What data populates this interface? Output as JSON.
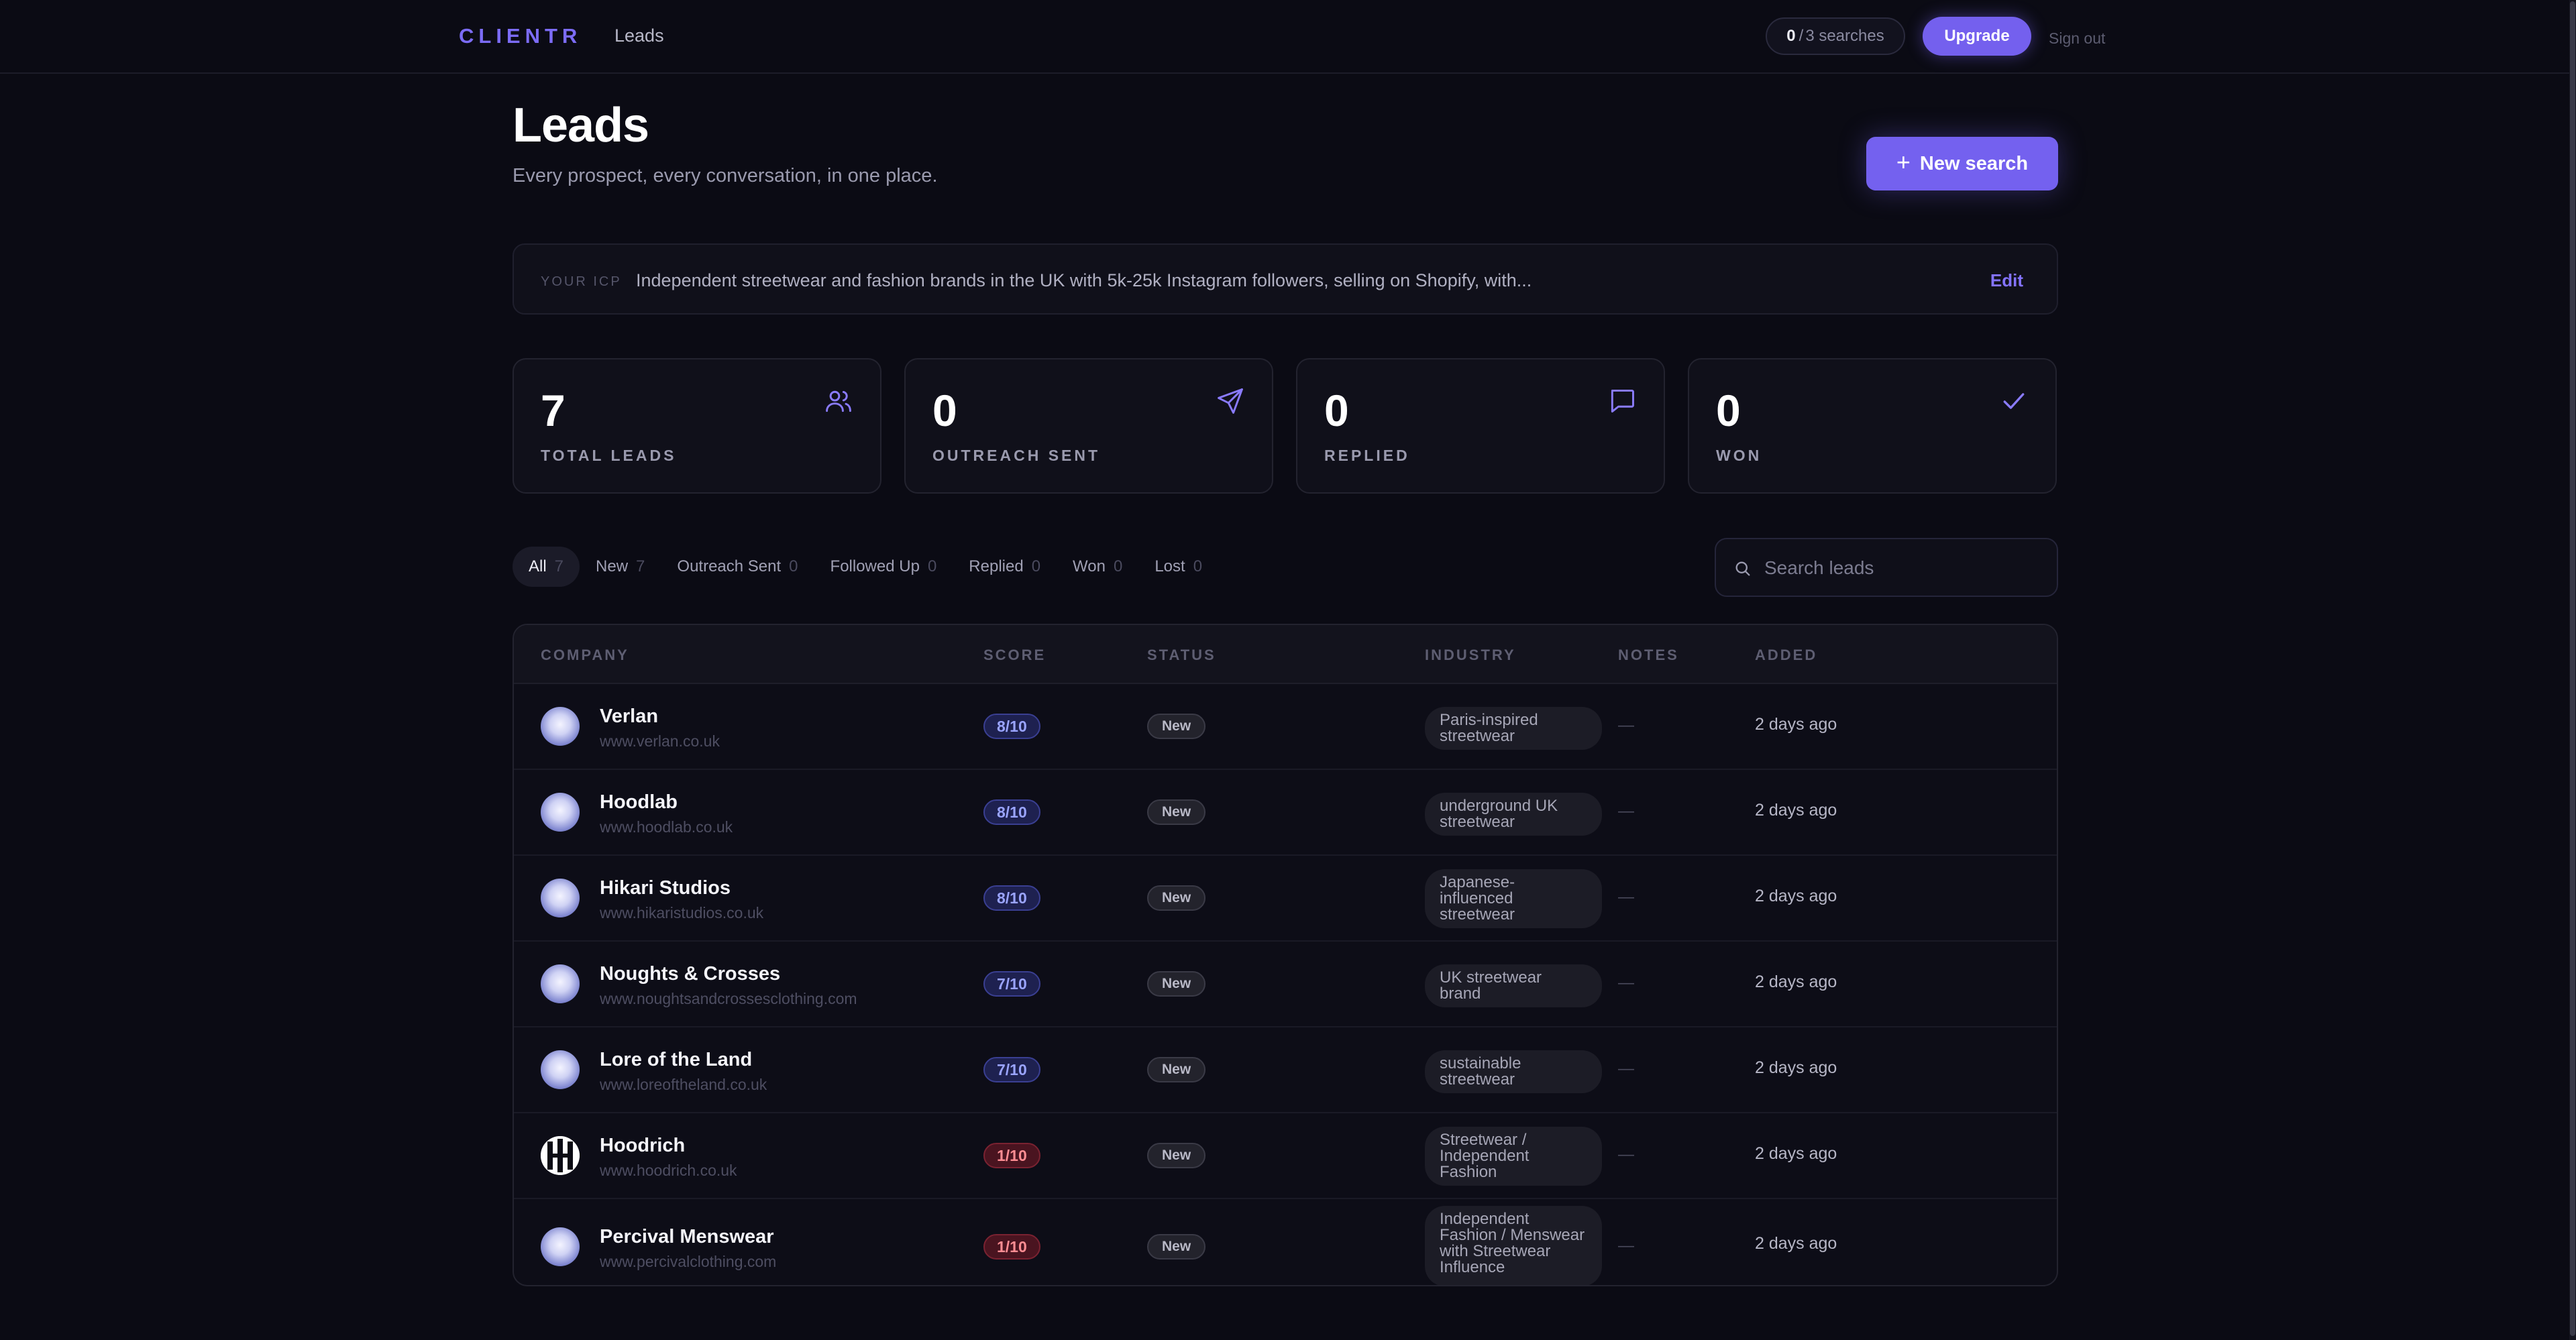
{
  "nav": {
    "brand": "CLIENTR",
    "leads_link": "Leads",
    "searches_used": "0",
    "searches_sep": "/",
    "searches_total": "3 searches",
    "upgrade_label": "Upgrade",
    "signout_label": "Sign out"
  },
  "header": {
    "title": "Leads",
    "subtitle": "Every prospect, every conversation, in one place.",
    "new_search_label": "New search"
  },
  "icp": {
    "label": "YOUR ICP",
    "text": "Independent streetwear and fashion brands in the UK with 5k-25k Instagram followers, selling on Shopify, with...",
    "edit_label": "Edit"
  },
  "stats": [
    {
      "value": "7",
      "label": "TOTAL LEADS",
      "icon": "users-icon"
    },
    {
      "value": "0",
      "label": "OUTREACH SENT",
      "icon": "send-icon"
    },
    {
      "value": "0",
      "label": "REPLIED",
      "icon": "message-icon"
    },
    {
      "value": "0",
      "label": "WON",
      "icon": "check-icon"
    }
  ],
  "filters": [
    {
      "label": "All",
      "count": "7"
    },
    {
      "label": "New",
      "count": "7"
    },
    {
      "label": "Outreach Sent",
      "count": "0"
    },
    {
      "label": "Followed Up",
      "count": "0"
    },
    {
      "label": "Replied",
      "count": "0"
    },
    {
      "label": "Won",
      "count": "0"
    },
    {
      "label": "Lost",
      "count": "0"
    }
  ],
  "search": {
    "placeholder": "Search leads"
  },
  "table": {
    "columns": [
      "COMPANY",
      "SCORE",
      "STATUS",
      "INDUSTRY",
      "NOTES",
      "ADDED"
    ],
    "rows": [
      {
        "name": "Verlan",
        "url": "www.verlan.co.uk",
        "score": "8/10",
        "status": "New",
        "industry": "Paris-inspired streetwear",
        "notes": "—",
        "added": "2 days ago"
      },
      {
        "name": "Hoodlab",
        "url": "www.hoodlab.co.uk",
        "score": "8/10",
        "status": "New",
        "industry": "underground UK streetwear",
        "notes": "—",
        "added": "2 days ago"
      },
      {
        "name": "Hikari Studios",
        "url": "www.hikaristudios.co.uk",
        "score": "8/10",
        "status": "New",
        "industry": "Japanese-influenced streetwear",
        "notes": "—",
        "added": "2 days ago"
      },
      {
        "name": "Noughts & Crosses",
        "url": "www.noughtsandcrossesclothing.com",
        "score": "7/10",
        "status": "New",
        "industry": "UK streetwear brand",
        "notes": "—",
        "added": "2 days ago"
      },
      {
        "name": "Lore of the Land",
        "url": "www.loreoftheland.co.uk",
        "score": "7/10",
        "status": "New",
        "industry": "sustainable streetwear",
        "notes": "—",
        "added": "2 days ago"
      },
      {
        "name": "Hoodrich",
        "url": "www.hoodrich.co.uk",
        "score": "1/10",
        "status": "New",
        "industry": "Streetwear / Independent Fashion",
        "notes": "—",
        "added": "2 days ago"
      },
      {
        "name": "Percival Menswear",
        "url": "www.percivalclothing.com",
        "score": "1/10",
        "status": "New",
        "industry": "Independent Fashion / Menswear with Streetwear Influence",
        "notes": "—",
        "added": "2 days ago"
      }
    ]
  },
  "colors": {
    "accent": "#7460ee",
    "background": "#0b0b14",
    "score_good": "#9aa4ff",
    "score_bad": "#ff8d93"
  }
}
